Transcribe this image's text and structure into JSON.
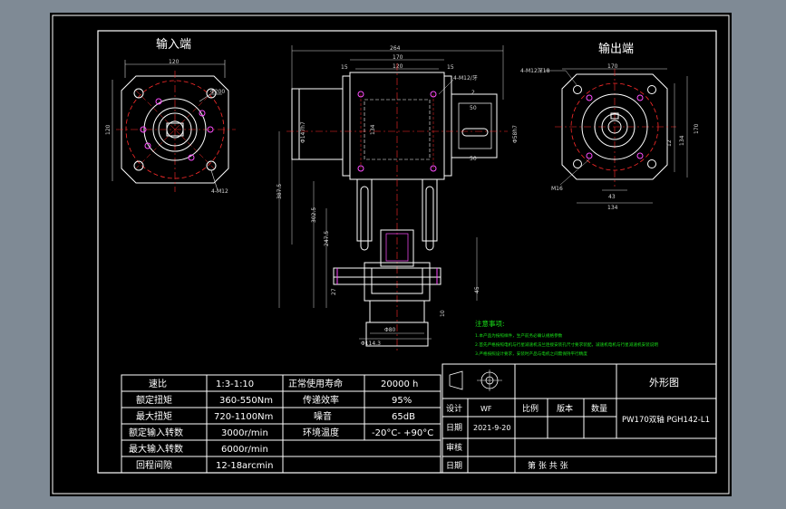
{
  "colors": {
    "canvas": "#000000",
    "frame": "#ffffff",
    "geometry": "#ffffff",
    "centerline": "#ff2b2b",
    "dimension": "#d8d8d8",
    "holes": "#ff4dff",
    "notes": "#19e019",
    "table_text": "#ffffff",
    "workspace": "#7f8a95"
  },
  "views": {
    "input_title": "输入端",
    "output_title": "输出端"
  },
  "dims": {
    "input_120_top": "120",
    "input_120_left": "120",
    "input_dia200": "Φ200",
    "input_holes": "4-M12",
    "front_264": "264",
    "front_170": "170",
    "front_120": "120",
    "front_15a": "15",
    "front_15b": "15",
    "front_thread": "4-M12/牙",
    "front_2": "2",
    "front_50a": "50",
    "front_50b": "50",
    "front_dia147": "Φ147h7",
    "front_134": "134",
    "front_dia58": "Φ58h7",
    "front_387": "387.5",
    "front_302": "302.5",
    "front_247": "247.5",
    "front_27": "27",
    "front_45": "45",
    "front_10": "10",
    "front_dia80": "Φ80",
    "front_dia114": "Φ114.3",
    "output_170": "170",
    "output_holes": "4-M12深18",
    "output_170_side": "170",
    "output_12": "12",
    "output_134_side": "134",
    "output_43": "43",
    "output_134_bot": "134",
    "output_m6": "M16"
  },
  "notes": {
    "title": "注意事项:",
    "lines": [
      "1.本产品为按照样件，生产前务必确认规格参数",
      "2.首先严格按照电机与行星减速机法兰连接安装孔尺寸要求装配，减速机电机与行星减速机安装说明",
      "3.严格按照设计要求，安装时产品与电机之间需保持平行精度"
    ]
  },
  "spec_table": {
    "rows": [
      [
        "速比",
        "1:3-1:10",
        "正常使用寿命",
        "20000 h"
      ],
      [
        "额定扭矩",
        "360-550Nm",
        "传递效率",
        "95%"
      ],
      [
        "最大扭矩",
        "720-1100Nm",
        "噪音",
        "65dB"
      ],
      [
        "额定输入转数",
        "3000r/min",
        "环境温度",
        "-20°C- +90°C"
      ],
      [
        "最大输入转数",
        "6000r/min",
        "",
        ""
      ],
      [
        "回程间隙",
        "12-18arcmin",
        "",
        ""
      ]
    ]
  },
  "title_block": {
    "drawing_name": "外形图",
    "design_label": "设计",
    "designer": "WF",
    "scale_label": "比例",
    "version_label": "版本",
    "quantity_label": "数量",
    "date_label": "日期",
    "date_value": "2021-9-20",
    "model": "PW170双轴 PGH142-L1",
    "review_label": "审核",
    "date_label2": "日期",
    "sheet_text": "第   张   共   张"
  }
}
